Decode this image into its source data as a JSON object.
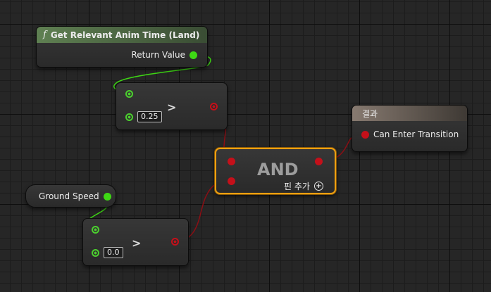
{
  "function_node": {
    "icon": "function-icon",
    "title": "Get Relevant Anim Time (Land)",
    "output_label": "Return Value"
  },
  "compare_top": {
    "operator": ">",
    "default_value": "0.25"
  },
  "compare_bottom": {
    "operator": ">",
    "default_value": "0.0"
  },
  "ground_speed": {
    "label": "Ground Speed"
  },
  "and_node": {
    "title": "AND",
    "add_pin_label": "핀 추가",
    "add_pin_icon": "plus-circle-icon"
  },
  "result_node": {
    "title": "결과",
    "input_label": "Can Enter Transition"
  },
  "colors": {
    "float_pin": "#3ed814",
    "bool_pin": "#c4101a",
    "selection": "#f0a010",
    "result_header": "#6b5f57",
    "function_header": "#4e6b44"
  }
}
